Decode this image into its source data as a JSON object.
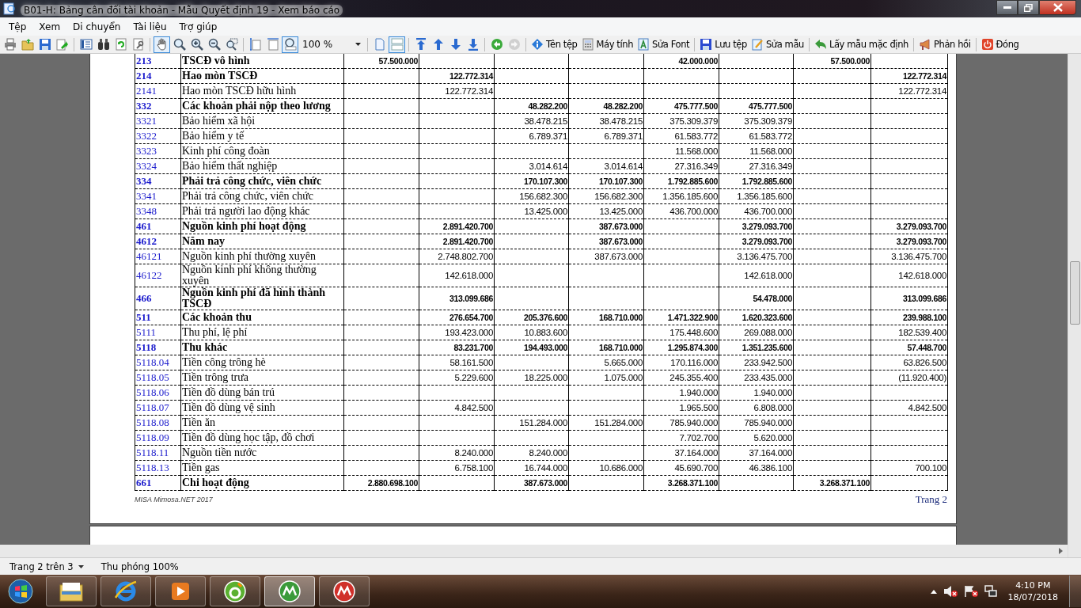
{
  "window": {
    "title": "B01-H: Bảng cân đối tài khoản  - Mẫu Quyết định 19 - Xem báo cáo"
  },
  "menu": [
    "Tệp",
    "Xem",
    "Di chuyển",
    "Tài liệu",
    "Trợ giúp"
  ],
  "toolbar": [
    {
      "kind": "icon",
      "selected": false,
      "disabled": false
    },
    {
      "kind": "icon",
      "selected": false,
      "disabled": false
    },
    {
      "kind": "icon",
      "selected": false,
      "disabled": false
    },
    {
      "kind": "icon",
      "selected": false,
      "disabled": false
    },
    {
      "kind": "separator"
    },
    {
      "kind": "icon",
      "selected": false,
      "disabled": false
    },
    {
      "kind": "icon",
      "selected": false,
      "disabled": false
    },
    {
      "kind": "icon",
      "selected": false,
      "disabled": false
    },
    {
      "kind": "icon",
      "selected": false,
      "disabled": false
    },
    {
      "kind": "separator"
    },
    {
      "kind": "icon",
      "selected": true,
      "disabled": false
    },
    {
      "kind": "icon",
      "selected": false,
      "disabled": false
    },
    {
      "kind": "icon",
      "selected": false,
      "disabled": false
    },
    {
      "kind": "icon",
      "selected": false,
      "disabled": false
    },
    {
      "kind": "icon",
      "selected": false,
      "disabled": false
    },
    {
      "kind": "separator"
    },
    {
      "kind": "icon",
      "selected": false,
      "disabled": false
    },
    {
      "kind": "icon",
      "selected": false,
      "disabled": false
    },
    {
      "kind": "icon",
      "selected": true,
      "disabled": false
    },
    {
      "kind": "zoom",
      "value": "100 %"
    },
    {
      "kind": "separator"
    },
    {
      "kind": "icon",
      "selected": false,
      "disabled": false
    },
    {
      "kind": "icon",
      "selected": true,
      "disabled": false
    },
    {
      "kind": "separator"
    },
    {
      "kind": "icon",
      "selected": false,
      "disabled": false
    },
    {
      "kind": "icon",
      "selected": false,
      "disabled": false
    },
    {
      "kind": "icon",
      "selected": false,
      "disabled": false
    },
    {
      "kind": "icon",
      "selected": false,
      "disabled": false
    },
    {
      "kind": "separator"
    },
    {
      "kind": "icon",
      "selected": false,
      "disabled": false
    },
    {
      "kind": "icon",
      "selected": false,
      "disabled": true
    },
    {
      "kind": "separator"
    },
    {
      "kind": "labeled",
      "label": "Tên tệp"
    },
    {
      "kind": "labeled",
      "label": "Máy tính"
    },
    {
      "kind": "labeled",
      "label": "Sửa Font"
    },
    {
      "kind": "separator"
    },
    {
      "kind": "labeled",
      "label": "Lưu tệp"
    },
    {
      "kind": "labeled",
      "label": "Sửa mẫu"
    },
    {
      "kind": "separator"
    },
    {
      "kind": "labeled",
      "label": "Lấy mẫu mặc định"
    },
    {
      "kind": "separator"
    },
    {
      "kind": "labeled",
      "label": "Phản hồi"
    },
    {
      "kind": "separator"
    },
    {
      "kind": "labeled",
      "label": "Đóng"
    }
  ],
  "report": {
    "rows": [
      {
        "code": "213",
        "name": "TSCĐ vô hình",
        "bold": true,
        "amounts": {
          "column_3": "57.500.000",
          "column_7": "42.000.000",
          "column_9": "57.500.000"
        }
      },
      {
        "code": "214",
        "name": "Hao mòn TSCĐ",
        "bold": true,
        "amounts": {
          "column_4": "122.772.314",
          "column_10": "122.772.314"
        }
      },
      {
        "code": "2141",
        "name": "Hao mòn TSCĐ hữu hình",
        "bold": false,
        "amounts": {
          "column_4": "122.772.314",
          "column_10": "122.772.314"
        }
      },
      {
        "code": "332",
        "name": "Các khoản phải nộp theo lương",
        "bold": true,
        "amounts": {
          "column_5": "48.282.200",
          "column_6": "48.282.200",
          "column_7": "475.777.500",
          "column_8": "475.777.500"
        }
      },
      {
        "code": "3321",
        "name": "Bảo hiểm xã hội",
        "bold": false,
        "amounts": {
          "column_5": "38.478.215",
          "column_6": "38.478.215",
          "column_7": "375.309.379",
          "column_8": "375.309.379"
        }
      },
      {
        "code": "3322",
        "name": "Bảo hiểm y tế",
        "bold": false,
        "amounts": {
          "column_5": "6.789.371",
          "column_6": "6.789.371",
          "column_7": "61.583.772",
          "column_8": "61.583.772"
        }
      },
      {
        "code": "3323",
        "name": "Kinh phí công đoàn",
        "bold": false,
        "amounts": {
          "column_7": "11.568.000",
          "column_8": "11.568.000"
        }
      },
      {
        "code": "3324",
        "name": "Bảo hiểm thất nghiệp",
        "bold": false,
        "amounts": {
          "column_5": "3.014.614",
          "column_6": "3.014.614",
          "column_7": "27.316.349",
          "column_8": "27.316.349"
        }
      },
      {
        "code": "334",
        "name": "Phải trả công chức, viên chức",
        "bold": true,
        "amounts": {
          "column_5": "170.107.300",
          "column_6": "170.107.300",
          "column_7": "1.792.885.600",
          "column_8": "1.792.885.600"
        }
      },
      {
        "code": "3341",
        "name": "Phải trả công chức, viên chức",
        "bold": false,
        "amounts": {
          "column_5": "156.682.300",
          "column_6": "156.682.300",
          "column_7": "1.356.185.600",
          "column_8": "1.356.185.600"
        }
      },
      {
        "code": "3348",
        "name": "Phải trả người lao động khác",
        "bold": false,
        "amounts": {
          "column_5": "13.425.000",
          "column_6": "13.425.000",
          "column_7": "436.700.000",
          "column_8": "436.700.000"
        }
      },
      {
        "code": "461",
        "name": "Nguồn kinh phí hoạt động",
        "bold": true,
        "amounts": {
          "column_4": "2.891.420.700",
          "column_6": "387.673.000",
          "column_8": "3.279.093.700",
          "column_10": "3.279.093.700"
        }
      },
      {
        "code": "4612",
        "name": "Năm nay",
        "bold": true,
        "amounts": {
          "column_4": "2.891.420.700",
          "column_6": "387.673.000",
          "column_8": "3.279.093.700",
          "column_10": "3.279.093.700"
        }
      },
      {
        "code": "46121",
        "name": "Nguồn kinh phí thường xuyên",
        "bold": false,
        "amounts": {
          "column_4": "2.748.802.700",
          "column_6": "387.673.000",
          "column_8": "3.136.475.700",
          "column_10": "3.136.475.700"
        }
      },
      {
        "code": "46122",
        "name": "Nguồn kinh phí không thường xuyên",
        "bold": false,
        "amounts": {
          "column_4": "142.618.000",
          "column_8": "142.618.000",
          "column_10": "142.618.000"
        }
      },
      {
        "code": "466",
        "name": "Nguồn kinh phí đã hình thành TSCĐ",
        "bold": true,
        "amounts": {
          "column_4": "313.099.686",
          "column_8": "54.478.000",
          "column_10": "313.099.686"
        }
      },
      {
        "code": "511",
        "name": "Các khoản thu",
        "bold": true,
        "amounts": {
          "column_4": "276.654.700",
          "column_5": "205.376.600",
          "column_6": "168.710.000",
          "column_7": "1.471.322.900",
          "column_8": "1.620.323.600",
          "column_10": "239.988.100"
        }
      },
      {
        "code": "5111",
        "name": "Thu phí, lệ phí",
        "bold": false,
        "amounts": {
          "column_4": "193.423.000",
          "column_5": "10.883.600",
          "column_7": "175.448.600",
          "column_8": "269.088.000",
          "column_10": "182.539.400"
        }
      },
      {
        "code": "5118",
        "name": "Thu khác",
        "bold": true,
        "amounts": {
          "column_4": "83.231.700",
          "column_5": "194.493.000",
          "column_6": "168.710.000",
          "column_7": "1.295.874.300",
          "column_8": "1.351.235.600",
          "column_10": "57.448.700"
        }
      },
      {
        "code": "5118.04",
        "name": "Tiền công trông hè",
        "bold": false,
        "amounts": {
          "column_4": "58.161.500",
          "column_6": "5.665.000",
          "column_7": "170.116.000",
          "column_8": "233.942.500",
          "column_10": "63.826.500"
        }
      },
      {
        "code": "5118.05",
        "name": "Tiền trông trưa",
        "bold": false,
        "amounts": {
          "column_4": "5.229.600",
          "column_5": "18.225.000",
          "column_6": "1.075.000",
          "column_7": "245.355.400",
          "column_8": "233.435.000",
          "column_10": "(11.920.400)"
        }
      },
      {
        "code": "5118.06",
        "name": "Tiền đồ dùng bán trú",
        "bold": false,
        "amounts": {
          "column_7": "1.940.000",
          "column_8": "1.940.000"
        }
      },
      {
        "code": "5118.07",
        "name": "Tiền đồ dùng vệ sinh",
        "bold": false,
        "amounts": {
          "column_4": "4.842.500",
          "column_7": "1.965.500",
          "column_8": "6.808.000",
          "column_10": "4.842.500"
        }
      },
      {
        "code": "5118.08",
        "name": "Tiền ăn",
        "bold": false,
        "amounts": {
          "column_5": "151.284.000",
          "column_6": "151.284.000",
          "column_7": "785.940.000",
          "column_8": "785.940.000"
        }
      },
      {
        "code": "5118.09",
        "name": "Tiền đồ dùng học tập, đồ chơi",
        "bold": false,
        "amounts": {
          "column_7": "7.702.700",
          "column_8": "5.620.000"
        }
      },
      {
        "code": "5118.11",
        "name": "Nguồn tiền nước",
        "bold": false,
        "amounts": {
          "column_4": "8.240.000",
          "column_5": "8.240.000",
          "column_7": "37.164.000",
          "column_8": "37.164.000"
        }
      },
      {
        "code": "5118.13",
        "name": "Tiền gas",
        "bold": false,
        "amounts": {
          "column_4": "6.758.100",
          "column_5": "16.744.000",
          "column_6": "10.686.000",
          "column_7": "45.690.700",
          "column_8": "46.386.100",
          "column_10": "700.100"
        }
      },
      {
        "code": "661",
        "name": "Chi hoạt động",
        "bold": true,
        "amounts": {
          "column_3": "2.880.698.100",
          "column_5": "387.673.000",
          "column_7": "3.268.371.100",
          "column_9": "3.268.371.100"
        }
      }
    ],
    "footer_note": "MISA Mimosa.NET 2017",
    "page_label": "Trang 2"
  },
  "status_bar": {
    "page": "Trang 2 trên 3",
    "zoom": "Thu phóng 100%"
  },
  "taskbar": {
    "apps": [
      {
        "selected": false
      },
      {
        "selected": false
      },
      {
        "selected": false
      },
      {
        "selected": false
      },
      {
        "selected": true
      },
      {
        "selected": false
      }
    ],
    "time": "4:10 PM",
    "date": "18/07/2018"
  }
}
